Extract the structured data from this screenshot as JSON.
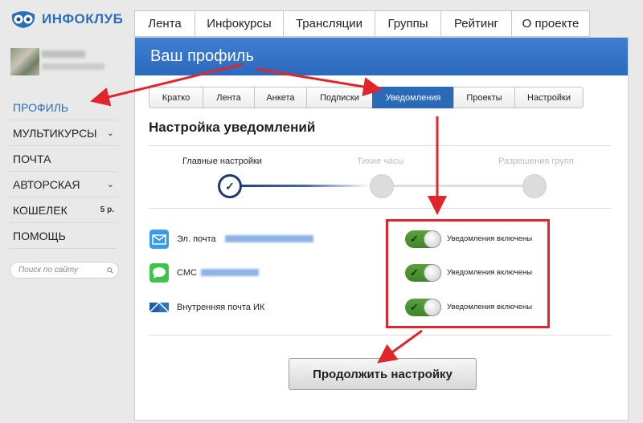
{
  "brand": {
    "name": "ИНФОКЛУБ"
  },
  "sidebar": {
    "items": [
      {
        "label": "ПРОФИЛЬ"
      },
      {
        "label": "МУЛЬТИКУРСЫ"
      },
      {
        "label": "ПОЧТА"
      },
      {
        "label": "АВТОРСКАЯ"
      },
      {
        "label": "КОШЕЛЕК",
        "amount": "5 р."
      },
      {
        "label": "ПОМОЩЬ"
      }
    ],
    "search_placeholder": "Поиск по сайту"
  },
  "top_nav": {
    "tabs": [
      "Лента",
      "Инфокурсы",
      "Трансляции",
      "Группы",
      "Рейтинг",
      "О проекте"
    ]
  },
  "profile": {
    "banner_title": "Ваш профиль",
    "tabs": [
      "Кратко",
      "Лента",
      "Анкета",
      "Подписки",
      "Уведомления",
      "Проекты",
      "Настройки"
    ],
    "active_tab": "Уведомления",
    "section_title": "Настройка уведомлений",
    "steps": [
      "Главные настройки",
      "Тихие часы",
      "Разрешения групп"
    ],
    "channels": [
      {
        "label": "Эл. почта",
        "icon": "mail-icon",
        "status": "Уведомления включены"
      },
      {
        "label": "СМС",
        "icon": "sms-icon",
        "status": "Уведомления включены"
      },
      {
        "label": "Внутренняя почта ИК",
        "icon": "internal-mail-icon",
        "status": "Уведомления включены"
      }
    ],
    "continue_label": "Продолжить настройку"
  },
  "colors": {
    "accent": "#2a6fb8",
    "toggle_on": "#4a9530",
    "annotation": "#e0262c"
  }
}
